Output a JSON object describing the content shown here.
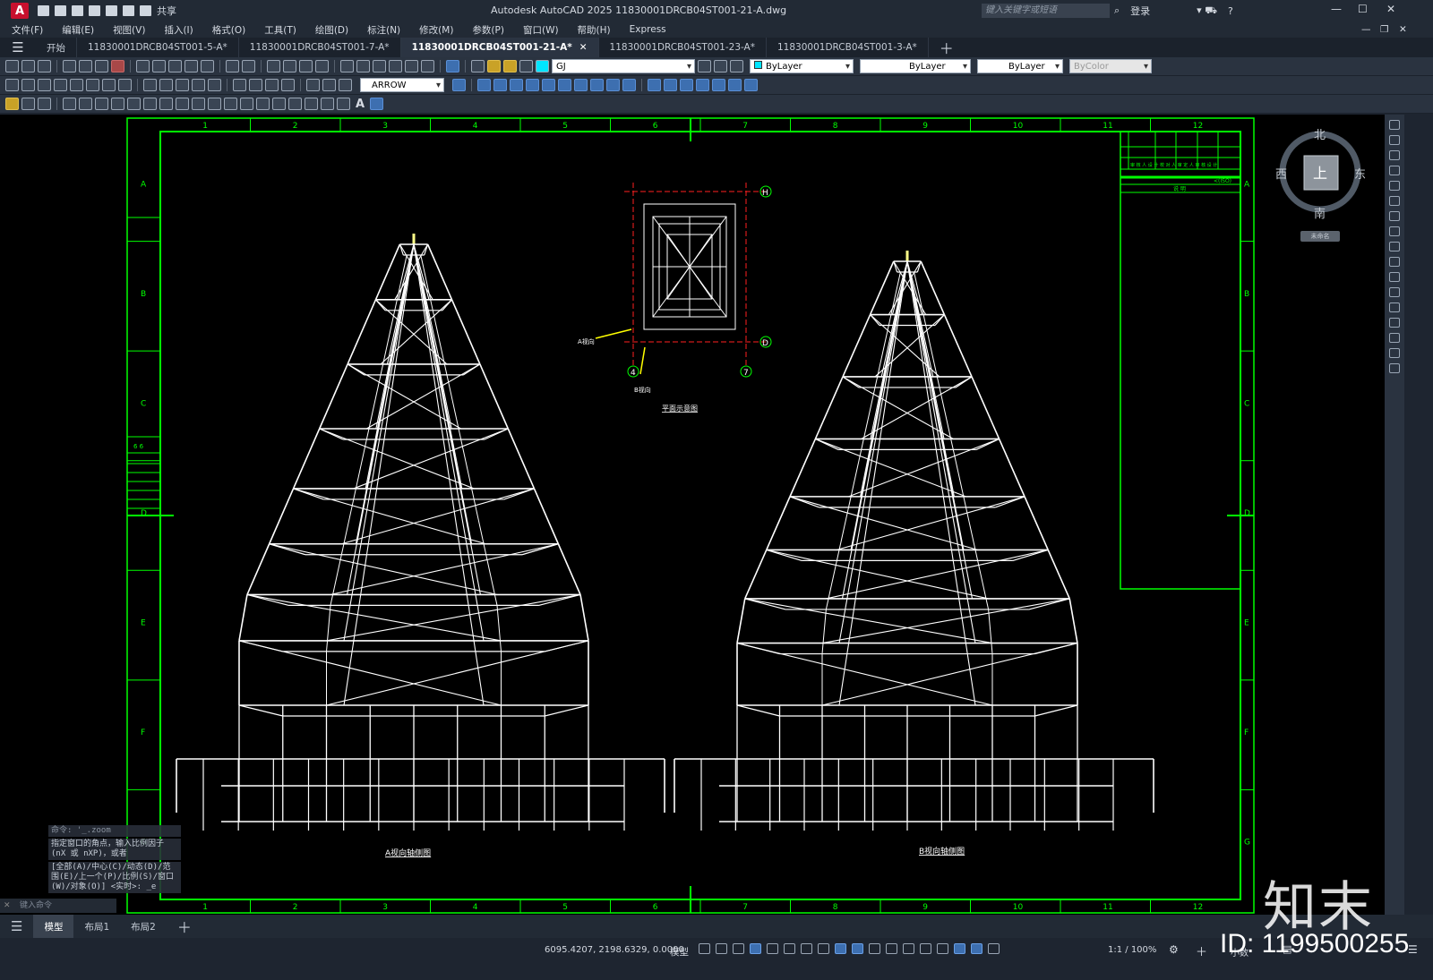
{
  "titlebar": {
    "app_logo": "A",
    "share": "共享",
    "title": "Autodesk AutoCAD 2025    11830001DRCB04ST001-21-A.dwg",
    "search_placeholder": "键入关键字或短语",
    "login": "登录",
    "help": "?"
  },
  "menu": [
    "文件(F)",
    "编辑(E)",
    "视图(V)",
    "插入(I)",
    "格式(O)",
    "工具(T)",
    "绘图(D)",
    "标注(N)",
    "修改(M)",
    "参数(P)",
    "窗口(W)",
    "帮助(H)",
    "Express"
  ],
  "tabs": [
    {
      "label": "开始",
      "active": false
    },
    {
      "label": "11830001DRCB04ST001-5-A*",
      "active": false
    },
    {
      "label": "11830001DRCB04ST001-7-A*",
      "active": false
    },
    {
      "label": "11830001DRCB04ST001-21-A*",
      "active": true
    },
    {
      "label": "11830001DRCB04ST001-23-A*",
      "active": false
    },
    {
      "label": "11830001DRCB04ST001-3-A*",
      "active": false
    }
  ],
  "toolbar": {
    "layer": "GJ",
    "color": "ByLayer",
    "linetype": "ByLayer",
    "lineweight": "ByLayer",
    "plotstyle": "ByColor",
    "dimstyle": "ARROW"
  },
  "drawing": {
    "col_labels": [
      "1",
      "2",
      "3",
      "4",
      "5",
      "6",
      "7",
      "8",
      "9",
      "10",
      "11",
      "12"
    ],
    "row_labels": [
      "A",
      "B",
      "C",
      "D",
      "E",
      "F",
      "G"
    ],
    "plan_caption": "平面示意图",
    "view_a_arrow": "A视向",
    "view_b_arrow": "B视向",
    "grid_h": "H",
    "grid_d": "D",
    "grid_4": "4",
    "grid_7": "7",
    "caption_a": "A视向轴侧图",
    "caption_b": "B视向轴侧图",
    "titleblock_row": "审 核 人   设 计   校 对 人   审 定 人   审 核   设 计",
    "titleblock_sub": "说 明",
    "titleblock_code": "<(ISO)",
    "side_label": "6  6"
  },
  "viewcube": {
    "north": "北",
    "south": "南",
    "east": "东",
    "west": "西",
    "top": "上",
    "wcs": "未命名"
  },
  "cmdline": {
    "l1": "命令: '_.zoom",
    "l2": "指定窗口的角点，输入比例因子(nX 或 nXP)，或者",
    "l3": "[全部(A)/中心(C)/动态(D)/范围(E)/上一个(P)/比例(S)/窗口(W)/对象(O)] <实时>: _e",
    "input_placeholder": "键入命令"
  },
  "layout_tabs": [
    "模型",
    "布局1",
    "布局2"
  ],
  "status": {
    "coords": "6095.4207, 2198.6329, 0.0000",
    "model": "模型",
    "scale": "1:1 / 100%",
    "units": "小数"
  },
  "watermark": {
    "brand": "知末",
    "id": "ID: 1199500255"
  }
}
